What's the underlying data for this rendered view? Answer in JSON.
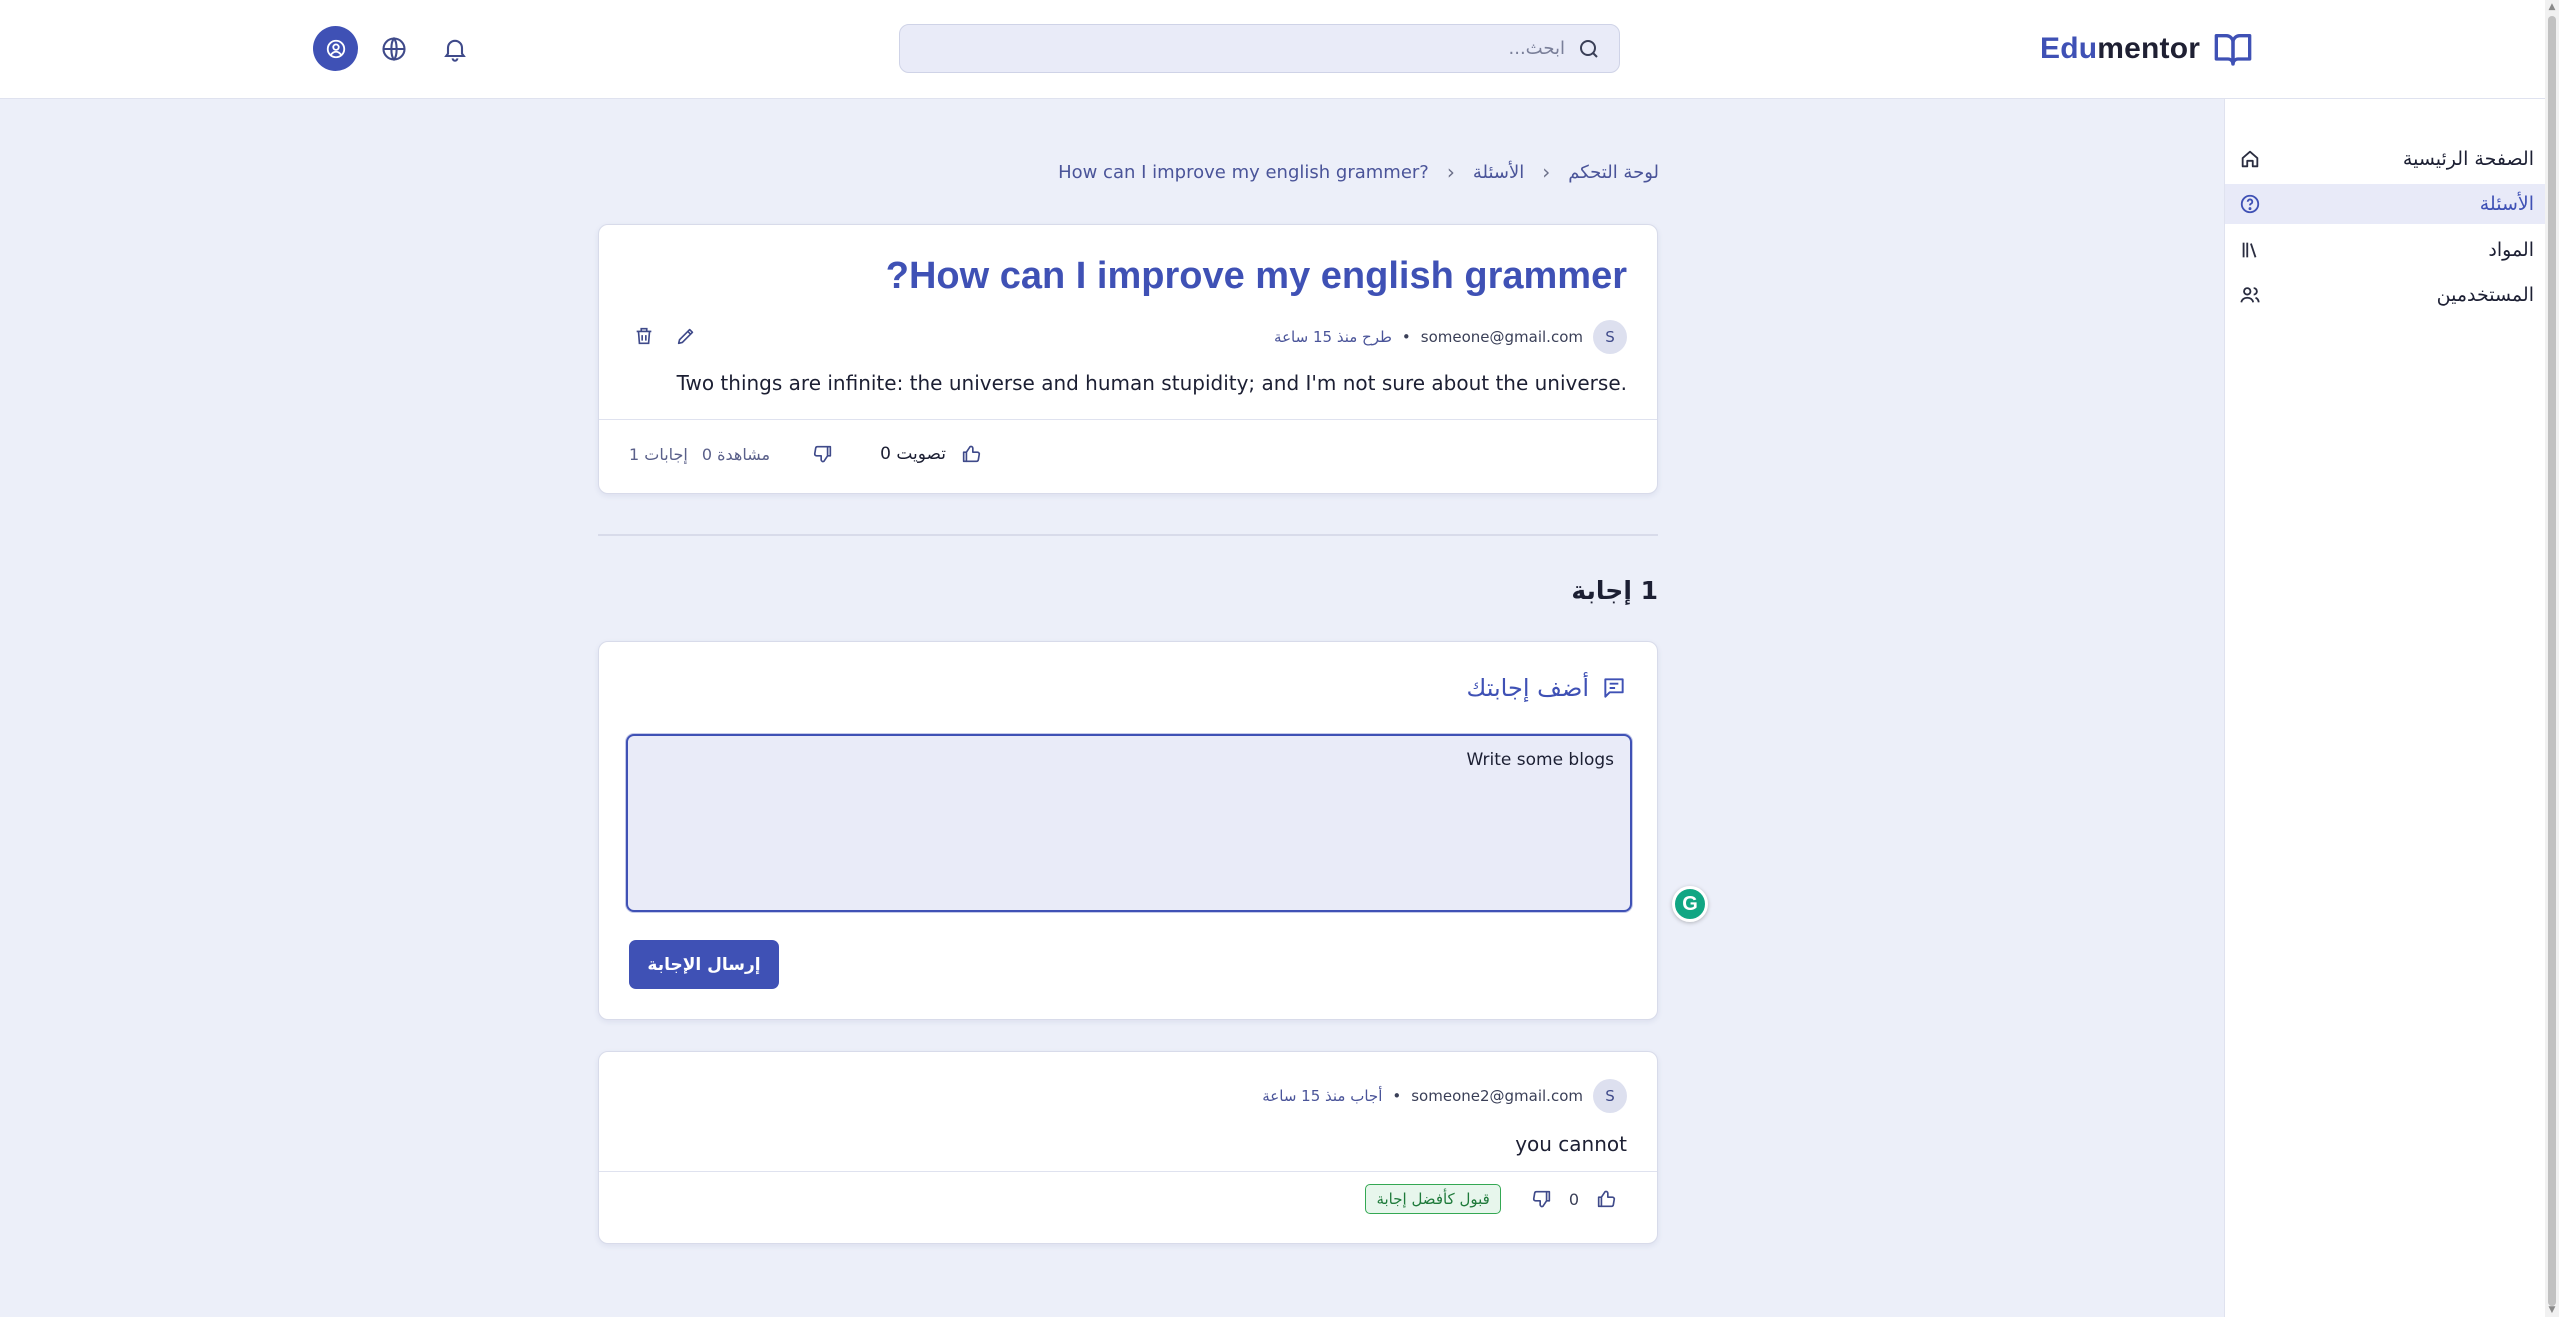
{
  "header": {
    "logo_prefix": "Edu",
    "logo_suffix": "mentor",
    "search_placeholder": "ابحث..."
  },
  "sidebar": {
    "items": [
      {
        "label": "الصفحة الرئيسية",
        "icon": "home-icon"
      },
      {
        "label": "الأسئلة",
        "icon": "question-circle-icon",
        "active": true
      },
      {
        "label": "المواد",
        "icon": "library-icon"
      },
      {
        "label": "المستخدمين",
        "icon": "users-icon"
      }
    ]
  },
  "breadcrumb": {
    "items": [
      "لوحة التحكم",
      "الأسئلة",
      "?How can I improve my english grammer"
    ]
  },
  "question": {
    "title": "?How can I improve my english grammer",
    "avatar_letter": "S",
    "author": "someone@gmail.com",
    "posted": "طرح منذ 15 ساعة",
    "body": "Two things are infinite: the universe and human stupidity; and I'm not sure about the universe.",
    "votes_label": "0 تصويت",
    "views_label": "0 مشاهدة",
    "answers_label": "1 إجابات"
  },
  "answers_heading": "1 إجابة",
  "answer_form": {
    "title": "أضف إجابتك",
    "value": "Write some blogs",
    "submit_label": "إرسال الإجابة"
  },
  "grammarly_letter": "G",
  "answers": [
    {
      "avatar_letter": "S",
      "author": "someone2@gmail.com",
      "posted": "أجاب منذ 15 ساعة",
      "body": "you cannot",
      "votes": "0",
      "accept_label": "قبول كأفضل إجابة"
    }
  ],
  "colors": {
    "primary": "#3f51b5",
    "background": "#eceff9",
    "accept_green": "#34a853"
  }
}
